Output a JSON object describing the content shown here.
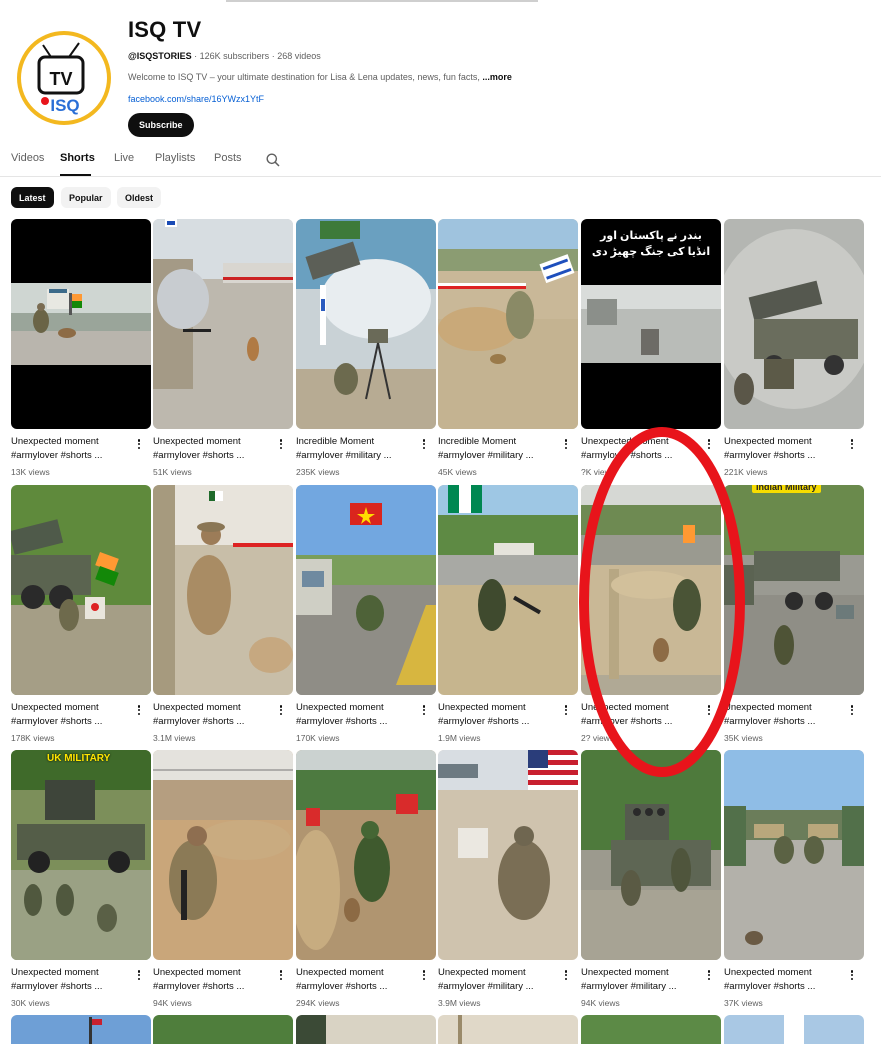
{
  "channel": {
    "name": "ISQ TV",
    "handle": "@ISQSTORIES",
    "subscribers": "126K subscribers",
    "videos": "268 videos",
    "description": "Welcome to ISQ TV – your ultimate destination for Lisa & Lena updates, news, fun facts,",
    "more_label": "...more",
    "link": "facebook.com/share/16YWzx1YtF",
    "subscribe_label": "Subscribe",
    "avatar_text": "TV",
    "avatar_subtext": "ISQ"
  },
  "tabs": [
    {
      "label": "Videos"
    },
    {
      "label": "Shorts"
    },
    {
      "label": "Live"
    },
    {
      "label": "Playlists"
    },
    {
      "label": "Posts"
    }
  ],
  "chips": [
    {
      "label": "Latest"
    },
    {
      "label": "Popular"
    },
    {
      "label": "Oldest"
    }
  ],
  "shorts": [
    {
      "title": "Unexpected moment",
      "subtitle": "#armylover #shorts ...",
      "views": "13K views"
    },
    {
      "title": "Unexpected moment",
      "subtitle": "#armylover #shorts ...",
      "views": "51K views"
    },
    {
      "title": "Incredible Moment",
      "subtitle": "#armylover #military ...",
      "views": "235K views"
    },
    {
      "title": "Incredible Moment",
      "subtitle": "#armylover #military ...",
      "views": "45K views"
    },
    {
      "title": "Unexpected moment",
      "subtitle": "#armylover #shorts ...",
      "views": "?K views",
      "overlay_text": "بندر نے پاکستان اور انڈیا کی جنگ چھیڑ دی"
    },
    {
      "title": "Unexpected moment",
      "subtitle": "#armylover #shorts ...",
      "views": "221K views"
    },
    {
      "title": "Unexpected moment",
      "subtitle": "#armylover #shorts ...",
      "views": "178K views"
    },
    {
      "title": "Unexpected moment",
      "subtitle": "#armylover #shorts ...",
      "views": "3.1M views"
    },
    {
      "title": "Unexpected moment",
      "subtitle": "#armylover #shorts ...",
      "views": "170K views"
    },
    {
      "title": "Unexpected moment",
      "subtitle": "#armylover #shorts ...",
      "views": "1.9M views"
    },
    {
      "title": "Unexpected moment",
      "subtitle": "#armylover #shorts ...",
      "views": "2? views"
    },
    {
      "title": "Unexpected moment",
      "subtitle": "#armylover #shorts ...",
      "views": "35K views",
      "badge": "Indian Military"
    },
    {
      "title": "Unexpected moment",
      "subtitle": "#armylover #shorts ...",
      "views": "30K views",
      "badge": "UK MILITARY"
    },
    {
      "title": "Unexpected moment",
      "subtitle": "#armylover #shorts ...",
      "views": "94K views"
    },
    {
      "title": "Unexpected moment",
      "subtitle": "#armylover #shorts ...",
      "views": "294K views"
    },
    {
      "title": "Unexpected moment",
      "subtitle": "#armylover #military ...",
      "views": "3.9M views"
    },
    {
      "title": "Unexpected moment",
      "subtitle": "#armylover #military ...",
      "views": "94K views"
    },
    {
      "title": "Unexpected moment",
      "subtitle": "#armylover #shorts ...",
      "views": "37K views"
    }
  ],
  "colors": {
    "highlight_oval": "#e8141b",
    "link": "#065fd4",
    "accent_gold": "#f3b81f"
  }
}
